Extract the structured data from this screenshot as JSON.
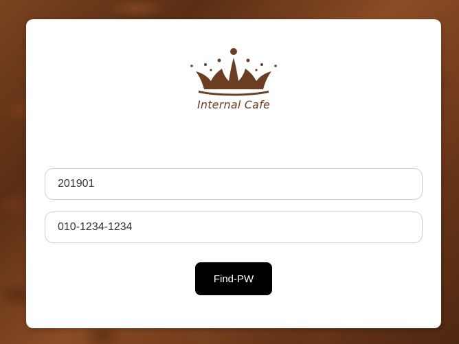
{
  "brand": {
    "name": "Internal Cafe",
    "logo_icon": "crown-icon",
    "color": "#6b3e22"
  },
  "form": {
    "employee_id": {
      "value": "201901",
      "placeholder": ""
    },
    "phone": {
      "value": "010-1234-1234",
      "placeholder": ""
    },
    "submit_label": "Find-PW"
  },
  "colors": {
    "button_bg": "#000000",
    "button_text": "#ffffff",
    "card_bg": "#ffffff"
  }
}
